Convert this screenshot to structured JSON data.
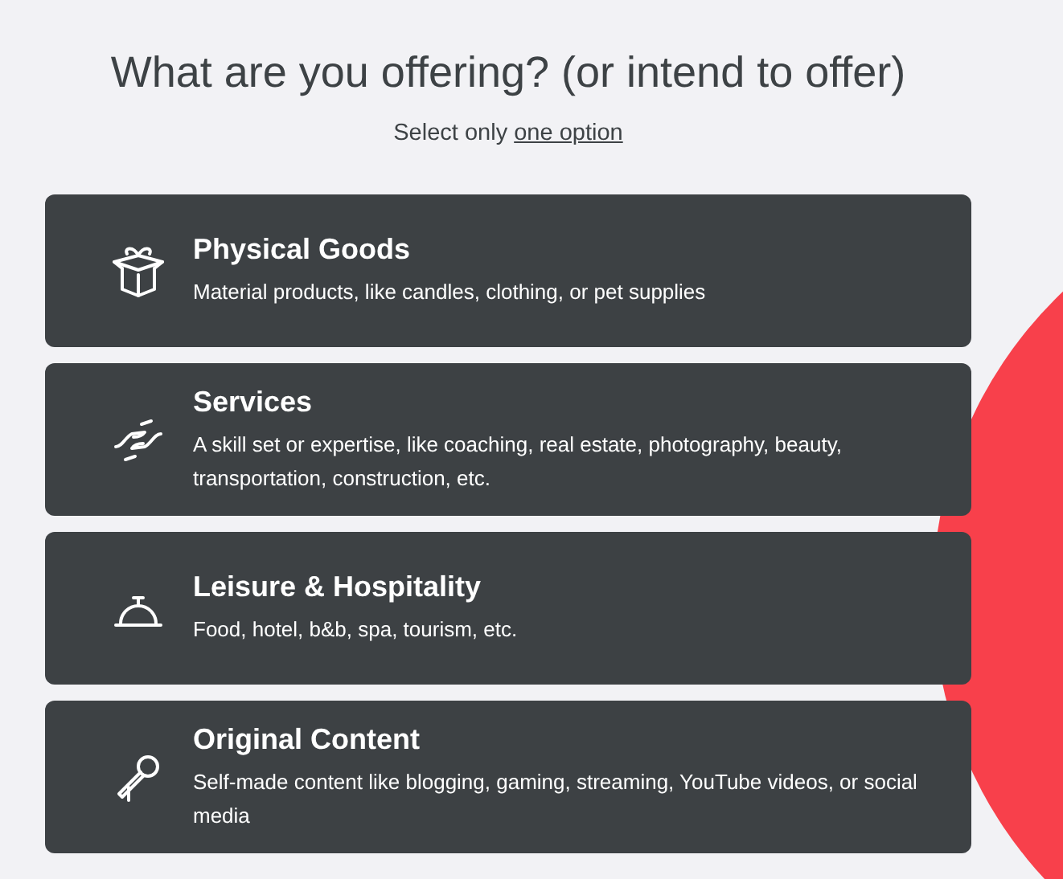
{
  "heading": "What are you offering? (or intend to offer)",
  "subtitle": {
    "text": "Select only",
    "link": "one option"
  },
  "options": [
    {
      "kind": "goods",
      "title": "Physical Goods",
      "description": "Material products, like candles, clothing, or pet supplies"
    },
    {
      "kind": "services",
      "title": "Services",
      "description": "A skill set or expertise, like coaching, real estate, photography, beauty, transportation, construction, etc."
    },
    {
      "kind": "hospitality",
      "title": "Leisure & Hospitality",
      "description": "Food, hotel, b&b, spa, tourism, etc."
    },
    {
      "kind": "content",
      "title": "Original Content",
      "description": "Self-made content like blogging, gaming, streaming, YouTube videos, or social media"
    }
  ]
}
